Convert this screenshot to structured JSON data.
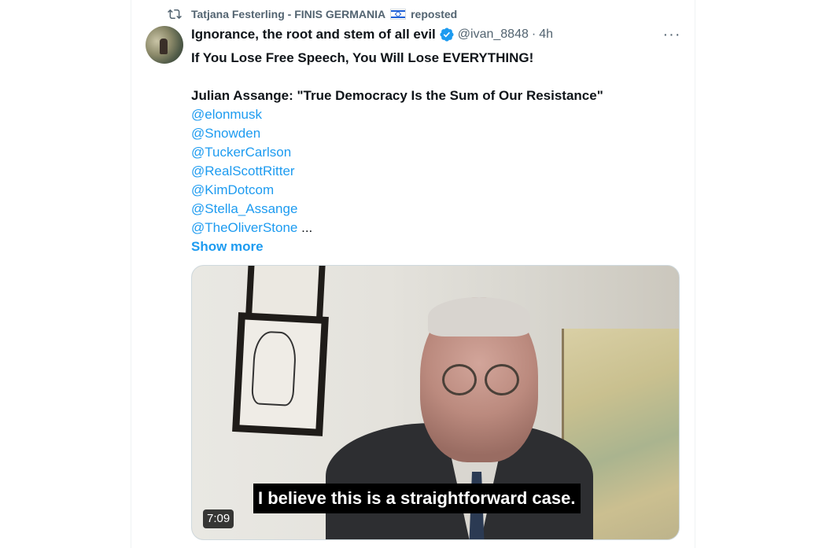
{
  "repost": {
    "name": "Tatjana Festerling - FINIS GERMANIA",
    "label": "reposted"
  },
  "tweet": {
    "display_name": "Ignorance, the root and stem of all evil",
    "handle": "@ivan_8848",
    "separator": "·",
    "time": "4h",
    "more_label": "···",
    "text_line1": "If You Lose Free Speech, You Will Lose EVERYTHING!",
    "text_line2": "Julian Assange: \"True Democracy Is the Sum of Our Resistance\"",
    "mentions": [
      "@elonmusk",
      "@Snowden",
      "@TuckerCarlson",
      "@RealScottRitter",
      "@KimDotcom",
      "@Stella_Assange",
      "@TheOliverStone"
    ],
    "ellipsis": "...",
    "show_more": "Show more"
  },
  "video": {
    "subtitle": "I believe this is a straightforward case.",
    "duration": "7:09"
  },
  "colors": {
    "accent": "#1d9bf0",
    "secondary_text": "#536471",
    "primary_text": "#0f1419"
  },
  "icons": [
    "repost-icon",
    "israel-flag-icon",
    "verified-badge-icon",
    "more-options-icon"
  ]
}
